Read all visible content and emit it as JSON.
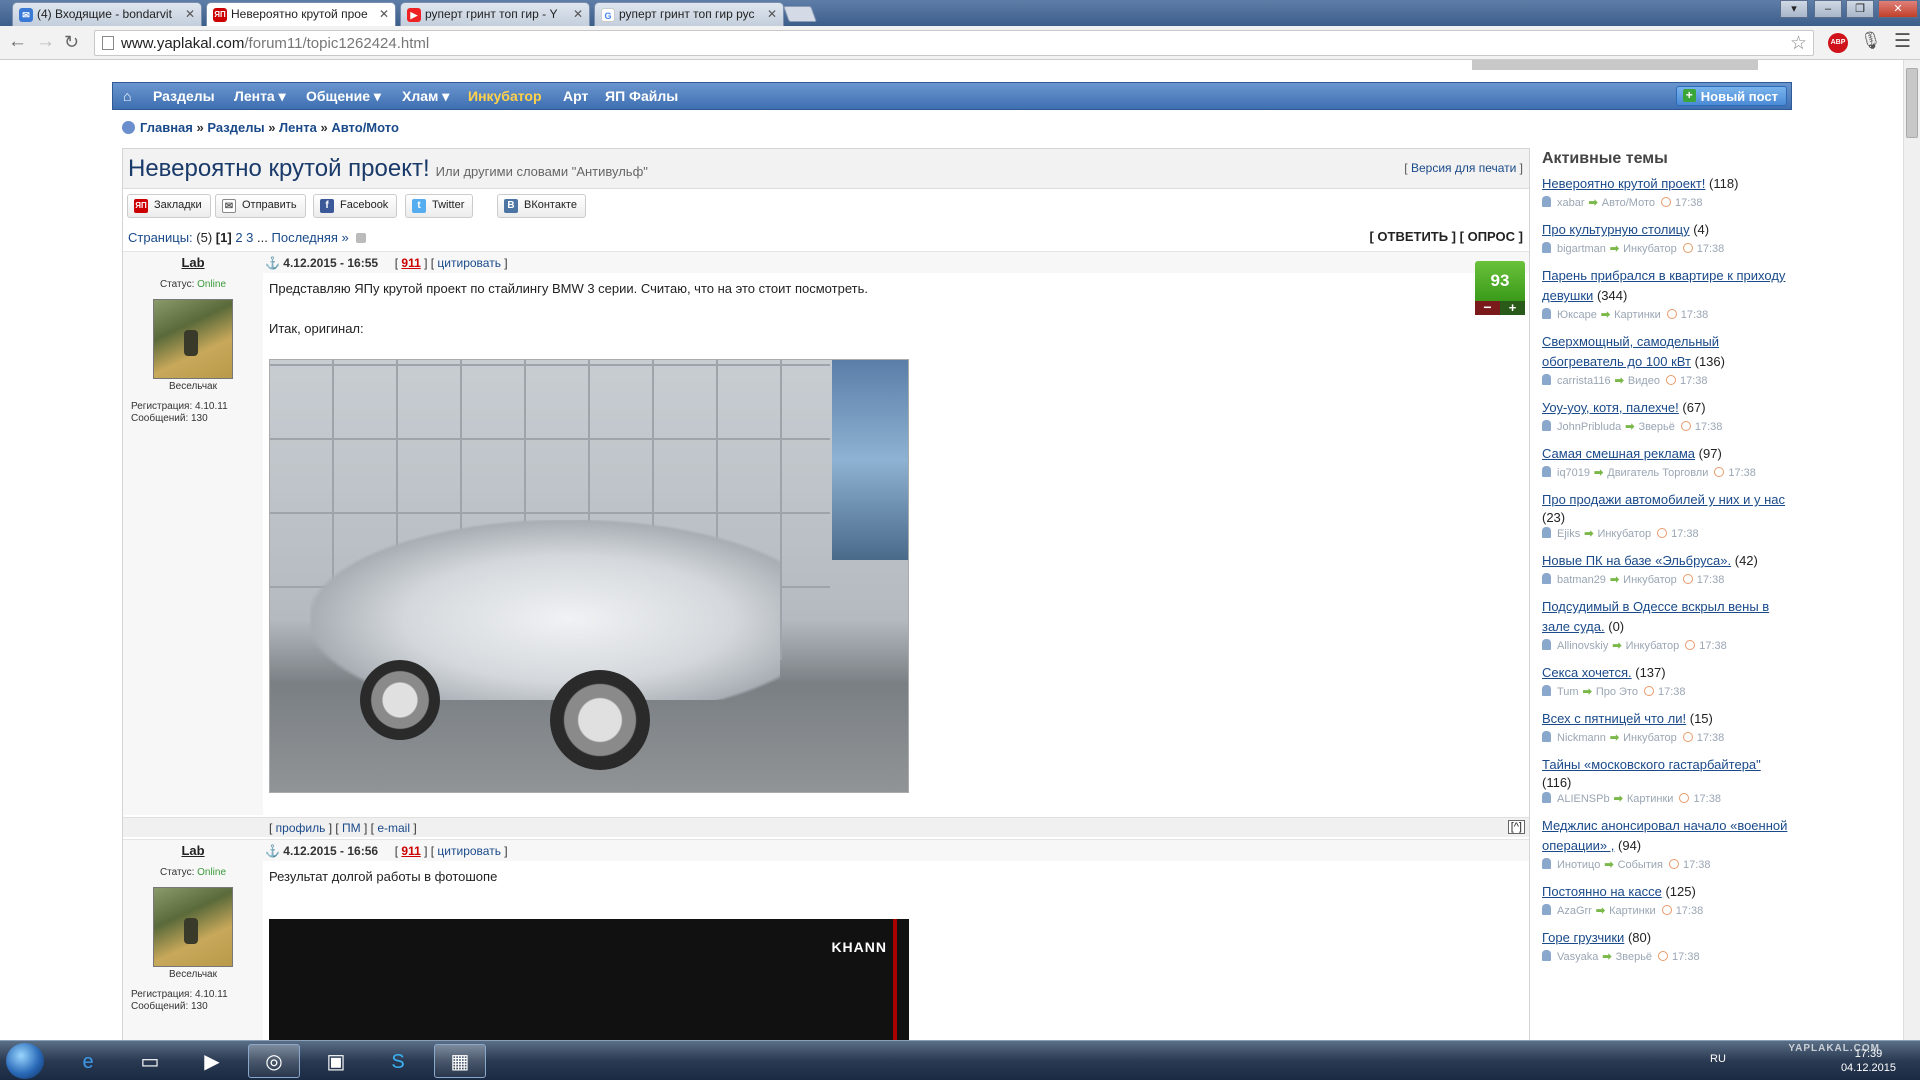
{
  "browser": {
    "tabs": [
      {
        "title": "(4) Входящие - bondarvit",
        "icon": "mail-icon",
        "active": false
      },
      {
        "title": "Невероятно крутой прое",
        "icon": "yaplakal-icon",
        "active": true
      },
      {
        "title": "руперт гринт топ гир - Y",
        "icon": "youtube-icon",
        "active": false
      },
      {
        "title": "руперт гринт топ гир рус",
        "icon": "google-icon",
        "active": false
      }
    ],
    "url_host": "www.yaplakal.com",
    "url_path": "/forum11/topic1262424.html",
    "abp_label": "ABP"
  },
  "nav": {
    "home_icon": "home-icon",
    "items": [
      "Разделы",
      "Лента ▾",
      "Общение ▾",
      "Хлам ▾",
      "Инкубатор",
      "Арт",
      "ЯП Файлы"
    ],
    "new_post": "Новый пост"
  },
  "breadcrumb": {
    "home": "Главная",
    "sections": "Разделы",
    "feed": "Лента",
    "forum": "Авто/Мото",
    "sep": "»"
  },
  "topic": {
    "title": "Невероятно крутой проект!",
    "subtitle": "Или другими словами \"Антивульф\"",
    "print_version": "Версия для печати",
    "share": [
      "Закладки",
      "Отправить",
      "Facebook",
      "Twitter",
      "ВКонтакте"
    ],
    "pages_label": "Страницы:",
    "pages_count": "(5)",
    "current_page": "[1]",
    "page2": "2",
    "page3": "3",
    "ellipsis": "...",
    "last_page": "Последняя »",
    "reply": "[ ОТВЕТИТЬ ]",
    "poll": "[ ОПРОС ]"
  },
  "posts": [
    {
      "author": "Lab",
      "status_label": "Статус:",
      "status": "Online",
      "rank": "Весельчак",
      "reg": "Регистрация: 4.10.11",
      "msgs": "Сообщений: 130",
      "date": "4.12.2015 - 16:55",
      "rep": "911",
      "quote": "цитировать",
      "text1": "Представляю ЯПу крутой проект по стайлингу BMW 3 серии. Считаю, что на это стоит посмотреть.",
      "text2": "Итак, оригинал:",
      "rating": "93",
      "footer": [
        "профиль",
        "ПМ",
        "e-mail"
      ]
    },
    {
      "author": "Lab",
      "status_label": "Статус:",
      "status": "Online",
      "rank": "Весельчак",
      "reg": "Регистрация: 4.10.11",
      "msgs": "Сообщений: 130",
      "date": "4.12.2015 - 16:56",
      "rep": "911",
      "quote": "цитировать",
      "text1": "Результат долгой работы в фотошопе",
      "image_brand": "KHANN"
    }
  ],
  "sidebar": {
    "title": "Активные темы",
    "topics": [
      {
        "title": "Невероятно крутой проект!",
        "count": "(118)",
        "user": "xabar",
        "section": "Авто/Мото",
        "time": "17:38"
      },
      {
        "title": "Про культурную столицу",
        "count": "(4)",
        "user": "bigartman",
        "section": "Инкубатор",
        "time": "17:38"
      },
      {
        "title": "Парень прибрался в квартире к приходу девушки",
        "count": "(344)",
        "user": "Юксаре",
        "section": "Картинки",
        "time": "17:38"
      },
      {
        "title": "Сверхмощный, самодельный обогреватель до 100 кВт",
        "count": "(136)",
        "user": "carrista116",
        "section": "Видео",
        "time": "17:38"
      },
      {
        "title": "Уоу-уоу, котя, палехче!",
        "count": "(67)",
        "user": "JohnPribluda",
        "section": "Зверьё",
        "time": "17:38"
      },
      {
        "title": "Самая смешная реклама",
        "count": "(97)",
        "user": "iq7019",
        "section": "Двигатель Торговли",
        "time": "17:38"
      },
      {
        "title": "Про продажи автомобилей у них и у нас",
        "count": "(23)",
        "user": "Ejiks",
        "section": "Инкубатор",
        "time": "17:38"
      },
      {
        "title": "Новые ПК на базе «Эльбруса».",
        "count": "(42)",
        "user": "batman29",
        "section": "Инкубатор",
        "time": "17:38"
      },
      {
        "title": "Подсудимый в Одессе вскрыл вены в зале суда.",
        "count": "(0)",
        "user": "Allinovskiy",
        "section": "Инкубатор",
        "time": "17:38"
      },
      {
        "title": "Секса хочется.",
        "count": "(137)",
        "user": "Tum",
        "section": "Про Это",
        "time": "17:38"
      },
      {
        "title": "Всех с пятницей что ли!",
        "count": "(15)",
        "user": "Nickmann",
        "section": "Инкубатор",
        "time": "17:38"
      },
      {
        "title": "Тайны «московского гастарбайтера\"",
        "count": "(116)",
        "user": "ALIENSPb",
        "section": "Картинки",
        "time": "17:38"
      },
      {
        "title": "Меджлис анонсировал начало «военной операции» ,",
        "count": "(94)",
        "user": "Инотицо",
        "section": "События",
        "time": "17:38"
      },
      {
        "title": "Постоянно на кассе",
        "count": "(125)",
        "user": "AzaGrr",
        "section": "Картинки",
        "time": "17:38"
      },
      {
        "title": "Горе грузчики",
        "count": "(80)",
        "user": "Vasyaka",
        "section": "Зверьё",
        "time": "17:38"
      }
    ]
  },
  "taskbar": {
    "lang": "RU",
    "watermark": "YAPLAKAL.COM",
    "time": "17:39",
    "date": "04.12.2015"
  }
}
